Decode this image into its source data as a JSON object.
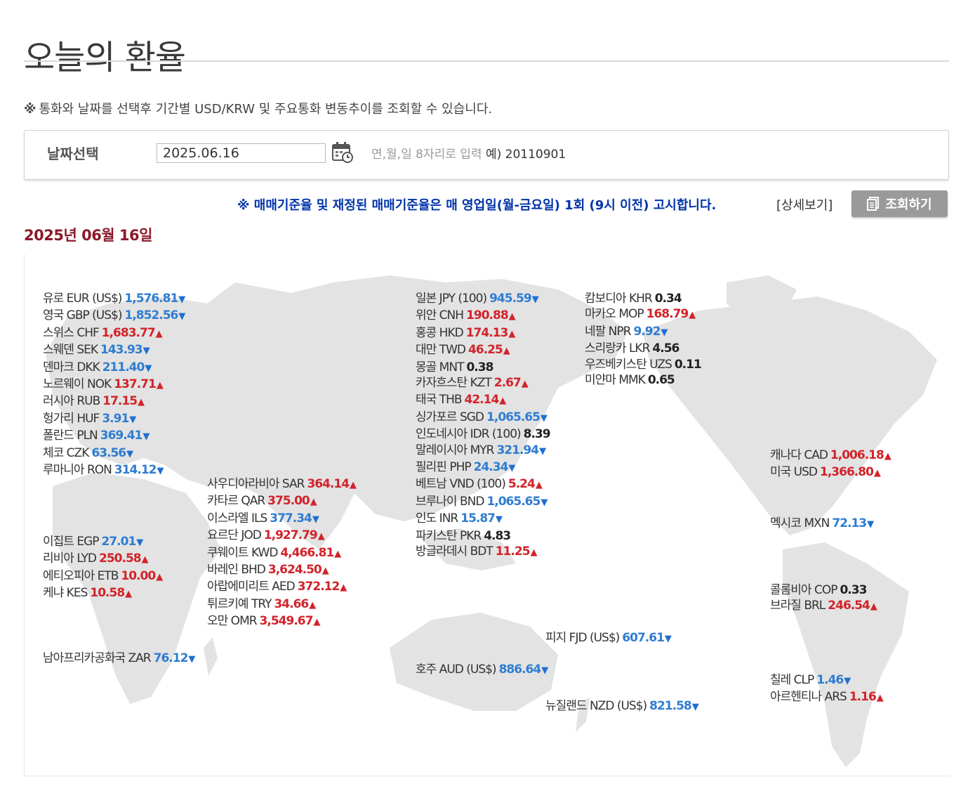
{
  "page": {
    "title": "오늘의 환율",
    "notice_mark": "※",
    "notice": "통화와 날짜를 선택후 기간별 USD/KRW 및 주요통화 변동추이를 조회할 수 있습니다."
  },
  "search": {
    "label": "날짜선택",
    "date_value": "2025.06.16",
    "hint": "연,월,일 8자리로 입력",
    "example": "예) 20110901"
  },
  "announcement": {
    "text": "※ 매매기준율 및 재정된 매매기준율은 매 영업일(월-금요일) 1회 (9시 이전) 고시합니다.",
    "detail_link": "[상세보기]",
    "query_button": "조회하기"
  },
  "date_heading": "2025년 06월 16일",
  "colors": {
    "up": "#d2232a",
    "down": "#2f7dd1",
    "heading": "#8b1a2b",
    "announce": "#0033aa",
    "button": "#9a9a9a"
  },
  "rates": {
    "europe": [
      {
        "name": "유로 EUR (US$)",
        "value": "1,576.81",
        "trend": "down"
      },
      {
        "name": "영국 GBP (US$)",
        "value": "1,852.56",
        "trend": "down"
      },
      {
        "name": "스위스 CHF",
        "value": "1,683.77",
        "trend": "up"
      },
      {
        "name": "스웨덴 SEK",
        "value": "143.93",
        "trend": "down"
      },
      {
        "name": "덴마크 DKK",
        "value": "211.40",
        "trend": "down"
      },
      {
        "name": "노르웨이 NOK",
        "value": "137.71",
        "trend": "up"
      },
      {
        "name": "러시아 RUB",
        "value": "17.15",
        "trend": "up"
      },
      {
        "name": "헝가리 HUF",
        "value": "3.91",
        "trend": "down"
      },
      {
        "name": "폴란드 PLN",
        "value": "369.41",
        "trend": "down"
      },
      {
        "name": "체코 CZK",
        "value": "63.56",
        "trend": "down"
      },
      {
        "name": "루마니아 RON",
        "value": "314.12",
        "trend": "down"
      }
    ],
    "africa": [
      {
        "name": "이집트 EGP",
        "value": "27.01",
        "trend": "down"
      },
      {
        "name": "리비아 LYD",
        "value": "250.58",
        "trend": "up"
      },
      {
        "name": "에티오피아 ETB",
        "value": "10.00",
        "trend": "up"
      },
      {
        "name": "케냐 KES",
        "value": "10.58",
        "trend": "up"
      }
    ],
    "south_africa": [
      {
        "name": "남아프리카공화국 ZAR",
        "value": "76.12",
        "trend": "down"
      }
    ],
    "middle_east": [
      {
        "name": "사우디아라비아 SAR",
        "value": "364.14",
        "trend": "up"
      },
      {
        "name": "카타르 QAR",
        "value": "375.00",
        "trend": "up"
      },
      {
        "name": "이스라엘 ILS",
        "value": "377.34",
        "trend": "down"
      },
      {
        "name": "요르단 JOD",
        "value": "1,927.79",
        "trend": "up"
      },
      {
        "name": "쿠웨이트 KWD",
        "value": "4,466.81",
        "trend": "up"
      },
      {
        "name": "바레인 BHD",
        "value": "3,624.50",
        "trend": "up"
      },
      {
        "name": "아랍에미리트 AED",
        "value": "372.12",
        "trend": "up"
      },
      {
        "name": "튀르키예 TRY",
        "value": "34.66",
        "trend": "up"
      },
      {
        "name": "오만 OMR",
        "value": "3,549.67",
        "trend": "up"
      }
    ],
    "asia": [
      {
        "name": "일본 JPY (100)",
        "value": "945.59",
        "trend": "down"
      },
      {
        "name": "위안 CNH",
        "value": "190.88",
        "trend": "up"
      },
      {
        "name": "홍콩 HKD",
        "value": "174.13",
        "trend": "up"
      },
      {
        "name": "대만 TWD",
        "value": "46.25",
        "trend": "up"
      },
      {
        "name": "몽골 MNT",
        "value": "0.38",
        "trend": "same"
      },
      {
        "name": "카자흐스탄 KZT",
        "value": "2.67",
        "trend": "up"
      },
      {
        "name": "태국 THB",
        "value": "42.14",
        "trend": "up"
      },
      {
        "name": "싱가포르 SGD",
        "value": "1,065.65",
        "trend": "down"
      },
      {
        "name": "인도네시아 IDR (100)",
        "value": "8.39",
        "trend": "same"
      },
      {
        "name": "말레이시아 MYR",
        "value": "321.94",
        "trend": "down"
      },
      {
        "name": "필리핀 PHP",
        "value": "24.34",
        "trend": "down"
      },
      {
        "name": "베트남 VND (100)",
        "value": "5.24",
        "trend": "up"
      },
      {
        "name": "브루나이 BND",
        "value": "1,065.65",
        "trend": "down"
      },
      {
        "name": "인도 INR",
        "value": "15.87",
        "trend": "down"
      },
      {
        "name": "파키스탄 PKR",
        "value": "4.83",
        "trend": "same"
      },
      {
        "name": "방글라데시 BDT",
        "value": "11.25",
        "trend": "up"
      }
    ],
    "asia2": [
      {
        "name": "캄보디아 KHR",
        "value": "0.34",
        "trend": "same"
      },
      {
        "name": "마카오 MOP",
        "value": "168.79",
        "trend": "up"
      },
      {
        "name": "네팔 NPR",
        "value": "9.92",
        "trend": "down"
      },
      {
        "name": "스리랑카 LKR",
        "value": "4.56",
        "trend": "same"
      },
      {
        "name": "우즈베키스탄 UZS",
        "value": "0.11",
        "trend": "same"
      },
      {
        "name": "미얀마 MMK",
        "value": "0.65",
        "trend": "same"
      }
    ],
    "north_america": [
      {
        "name": "캐나다 CAD",
        "value": "1,006.18",
        "trend": "up"
      },
      {
        "name": "미국 USD",
        "value": "1,366.80",
        "trend": "up"
      }
    ],
    "mexico": [
      {
        "name": "멕시코 MXN",
        "value": "72.13",
        "trend": "down"
      }
    ],
    "south_america": [
      {
        "name": "콜롬비아 COP",
        "value": "0.33",
        "trend": "same"
      },
      {
        "name": "브라질 BRL",
        "value": "246.54",
        "trend": "up"
      }
    ],
    "chile_arg": [
      {
        "name": "칠레 CLP",
        "value": "1.46",
        "trend": "down"
      },
      {
        "name": "아르헨티나 ARS",
        "value": "1.16",
        "trend": "up"
      }
    ],
    "fiji": [
      {
        "name": "피지 FJD (US$)",
        "value": "607.61",
        "trend": "down"
      }
    ],
    "australia": [
      {
        "name": "호주 AUD (US$)",
        "value": "886.64",
        "trend": "down"
      }
    ],
    "nz": [
      {
        "name": "뉴질랜드 NZD (US$)",
        "value": "821.58",
        "trend": "down"
      }
    ]
  }
}
